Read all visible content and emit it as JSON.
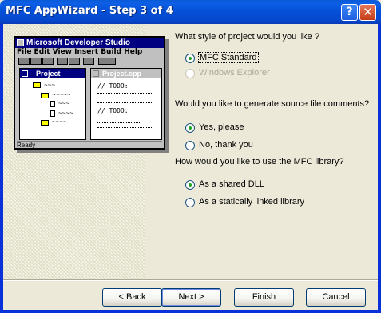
{
  "window": {
    "title": "MFC AppWizard - Step 3 of 4",
    "help_icon": "?",
    "close_icon": "✕"
  },
  "illustration": {
    "title": "Microsoft Developer Studio",
    "menu": "File Edit View Insert Build Help",
    "project_pane": "Project",
    "file_pane": "Project.cpp",
    "todo": "// TODO:",
    "status": "Ready"
  },
  "questions": {
    "style": {
      "label": "What style of project would you like ?",
      "options": [
        {
          "label": "MFC Standard",
          "checked": true,
          "disabled": false
        },
        {
          "label": "Windows Explorer",
          "checked": false,
          "disabled": true
        }
      ]
    },
    "comments": {
      "label": "Would you like to generate source file comments?",
      "options": [
        {
          "label": "Yes, please",
          "checked": true,
          "disabled": false
        },
        {
          "label": "No, thank you",
          "checked": false,
          "disabled": false
        }
      ]
    },
    "library": {
      "label": "How would you like to use the MFC library?",
      "options": [
        {
          "label": "As a shared DLL",
          "checked": true,
          "disabled": false
        },
        {
          "label": "As a statically linked library",
          "checked": false,
          "disabled": false
        }
      ]
    }
  },
  "buttons": {
    "back": "< Back",
    "next": "Next >",
    "finish": "Finish",
    "cancel": "Cancel"
  },
  "colors": {
    "titlebar": "#0451d8",
    "radio_check": "#21a121"
  }
}
